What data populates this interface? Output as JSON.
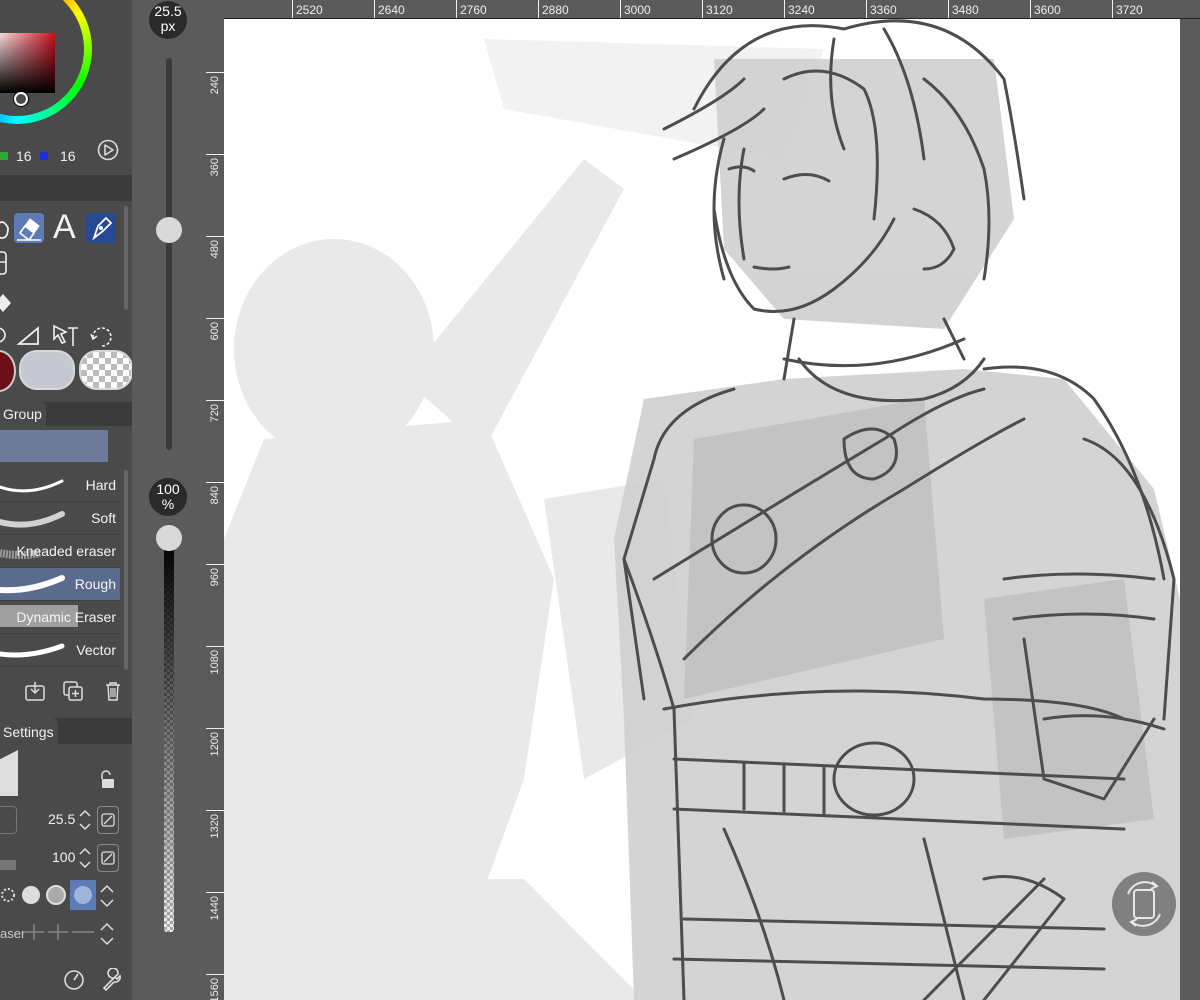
{
  "color_panel": {
    "green_value": "16",
    "blue_value": "16",
    "current_color": "#6b0f18"
  },
  "tools": {
    "text_tool_glyph": "A"
  },
  "brush_group": {
    "tab_label": "Group",
    "items": [
      {
        "label": "Hard"
      },
      {
        "label": "Soft"
      },
      {
        "label": "Kneaded eraser"
      },
      {
        "label": "Rough"
      },
      {
        "label": "Dynamic Eraser"
      },
      {
        "label": "Vector"
      }
    ],
    "selected_index": 3
  },
  "settings": {
    "tab_label": "Settings",
    "brush_size": "25.5",
    "opacity": "100",
    "partial_label": "aser"
  },
  "slider": {
    "size_value": "25.5",
    "size_unit": "px",
    "opacity_value": "100",
    "opacity_unit": "%"
  },
  "ruler": {
    "top_labels": [
      "2520",
      "2640",
      "2760",
      "2880",
      "3000",
      "3120",
      "3240",
      "3360",
      "3480",
      "3600",
      "3720"
    ],
    "left_labels": [
      "240",
      "360",
      "480",
      "600",
      "720",
      "840",
      "960",
      "1080",
      "1200",
      "1320",
      "1440",
      "1560"
    ]
  }
}
